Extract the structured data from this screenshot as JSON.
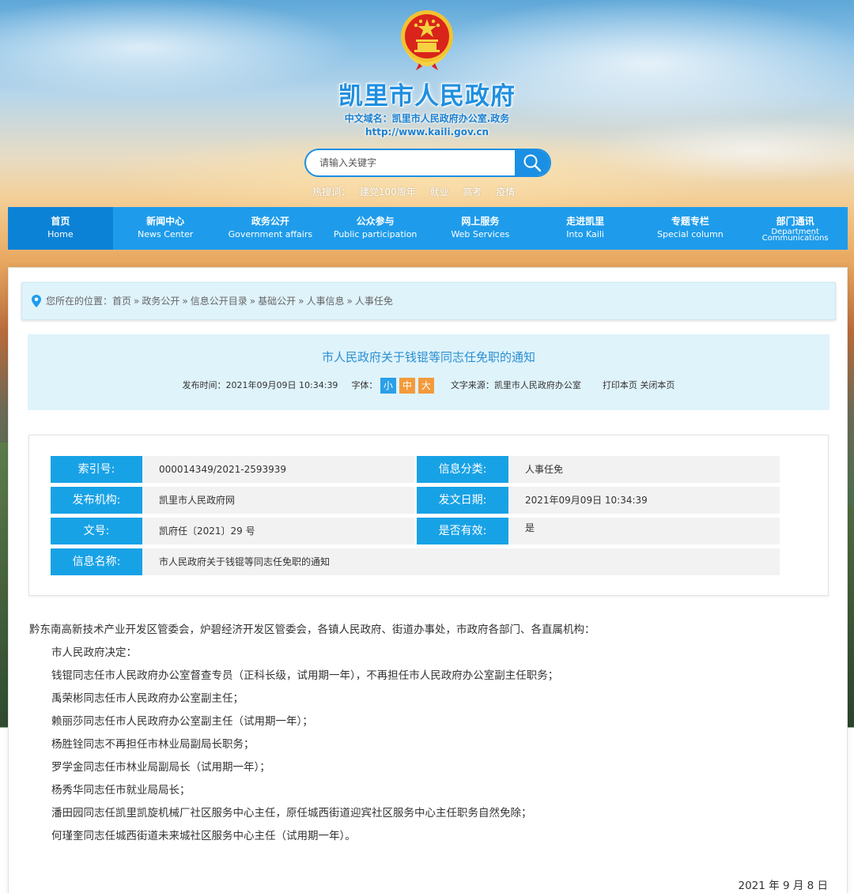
{
  "header": {
    "title": "凯里市人民政府",
    "domain_label": "中文域名：凯里市人民政府办公室.政务",
    "url": "http://www.kaili.gov.cn",
    "search_placeholder": "请输入关键字",
    "hot_label": "热搜词：",
    "hot_words": [
      "建党100周年",
      "就业",
      "高考",
      "疫情"
    ]
  },
  "nav": [
    {
      "cn": "首页",
      "en": "Home"
    },
    {
      "cn": "新闻中心",
      "en": "News Center"
    },
    {
      "cn": "政务公开",
      "en": "Government affairs"
    },
    {
      "cn": "公众参与",
      "en": "Public participation"
    },
    {
      "cn": "网上服务",
      "en": "Web Services"
    },
    {
      "cn": "走进凯里",
      "en": "Into Kaili"
    },
    {
      "cn": "专题专栏",
      "en": "Special column"
    },
    {
      "cn": "部门通讯",
      "en_line1": "Department",
      "en_line2": "Communications"
    }
  ],
  "breadcrumb": {
    "prefix": "您所在的位置：",
    "items": [
      "首页",
      "政务公开",
      "信息公开目录",
      "基础公开",
      "人事信息",
      "人事任免"
    ],
    "separator": "»"
  },
  "article": {
    "title": "市人民政府关于钱锟等同志任免职的通知",
    "publish_label": "发布时间：",
    "publish_time": "2021年09月09日 10:34:39",
    "font_label": "字体：",
    "font_small": "小",
    "font_medium": "中",
    "font_large": "大",
    "source_label": "文字来源：",
    "source": "凯里市人民政府办公室",
    "print": "打印本页",
    "close": "关闭本页"
  },
  "info": {
    "index_label": "索引号:",
    "index_value": "000014349/2021-2593939",
    "category_label": "信息分类:",
    "category_value": "人事任免",
    "org_label": "发布机构:",
    "org_value": "凯里市人民政府网",
    "date_label": "发文日期:",
    "date_value": "2021年09月09日 10:34:39",
    "docno_label": "文号:",
    "docno_value": "凯府任〔2021〕29 号",
    "valid_label": "是否有效:",
    "valid_value": "是",
    "name_label": "信息名称:",
    "name_value": "市人民政府关于钱锟等同志任免职的通知"
  },
  "body": {
    "salutation": "黔东南高新技术产业开发区管委会，炉碧经济开发区管委会，各镇人民政府、街道办事处，市政府各部门、各直属机构：",
    "paragraphs": [
      "市人民政府决定：",
      "钱锟同志任市人民政府办公室督查专员（正科长级，试用期一年），不再担任市人民政府办公室副主任职务；",
      "禹荣彬同志任市人民政府办公室副主任；",
      "赖丽莎同志任市人民政府办公室副主任（试用期一年）；",
      "杨胜铨同志不再担任市林业局副局长职务；",
      "罗学金同志任市林业局副局长（试用期一年）；",
      "杨秀华同志任市就业局局长；",
      "潘田园同志任凯里凯旋机械厂社区服务中心主任，原任城西街道迎宾社区服务中心主任职务自然免除；",
      "何瑾奎同志任城西街道未来城社区服务中心主任（试用期一年）。"
    ],
    "date": "2021 年 9 月 8 日"
  }
}
